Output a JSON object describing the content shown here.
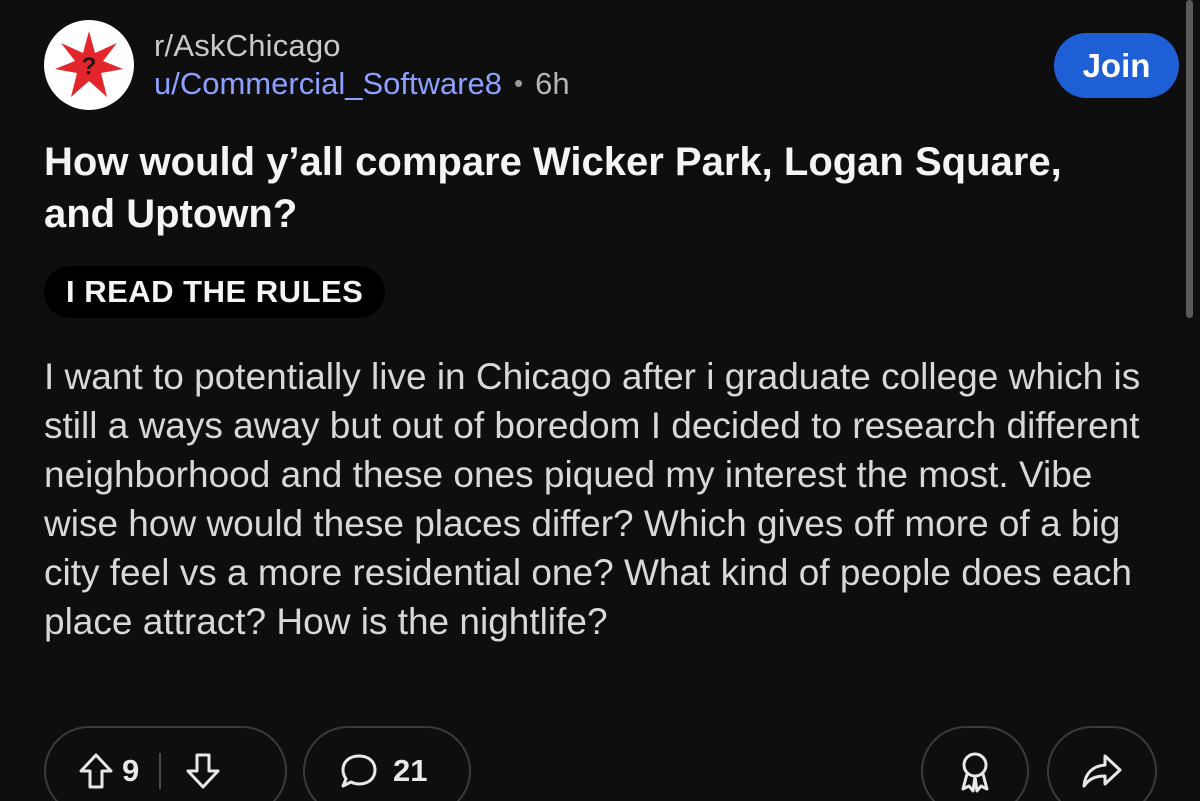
{
  "header": {
    "subreddit": "r/AskChicago",
    "username": "u/Commercial_Software8",
    "separator": "•",
    "age": "6h",
    "join_label": "Join",
    "avatar_icon": "chicago-star-question-icon"
  },
  "post": {
    "title": "How would y’all compare Wicker Park, Logan Square, and Uptown?",
    "flair": "I READ THE RULES",
    "body": "I want to potentially live in Chicago after i graduate college which is still a ways away but out of boredom I decided to research different neighborhood and these ones piqued my interest the most. Vibe wise how would these places differ? Which gives off more of a big city feel vs a more residential one? What kind of people does each place attract? How is the nightlife?"
  },
  "actions": {
    "upvote_icon": "upvote-arrow-icon",
    "vote_count": "9",
    "downvote_icon": "downvote-arrow-icon",
    "comment_icon": "comment-bubble-icon",
    "comment_count": "21",
    "award_icon": "award-icon",
    "share_icon": "share-arrow-icon"
  },
  "colors": {
    "background": "#0e0e0e",
    "accent": "#1e5fd6",
    "username": "#8ea0ff",
    "star_red": "#e3262b"
  }
}
